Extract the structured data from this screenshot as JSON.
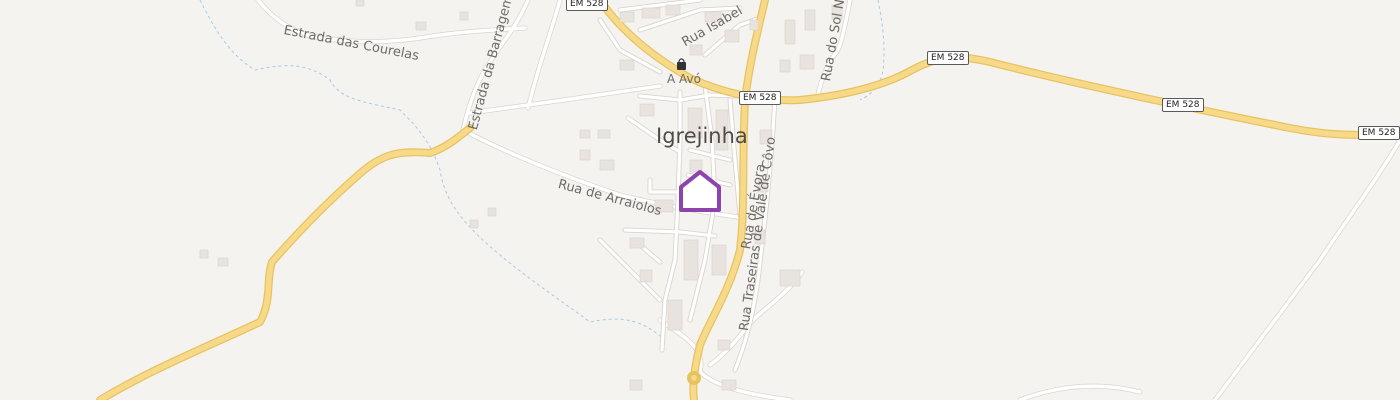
{
  "map": {
    "place_name": "Igrejinha",
    "poi_label": "A Avó",
    "road_shields": [
      "EM 528",
      "EM 528",
      "EM 528",
      "EM 528",
      "EM 528"
    ],
    "street_labels": [
      "Estrada das Courelas",
      "Estrada da Barragem do",
      "Rua Isabel",
      "Rua do Sol Na",
      "Rua de Arraiolos",
      "Rua de Évora",
      "Rua Traseiras de Vale de Côvo"
    ],
    "colors": {
      "background": "#f5f3f0",
      "main_road": "#f7d98a",
      "main_road_casing": "#e8c25e",
      "minor_road": "#ffffff",
      "minor_road_casing": "#d9d4cf",
      "waterway": "#a8c8e8",
      "marker": "#8e44ad",
      "label_text": "#6f6a66"
    },
    "marker_icon": "home-marker-icon",
    "poi_icon": "shop-bag-icon"
  }
}
